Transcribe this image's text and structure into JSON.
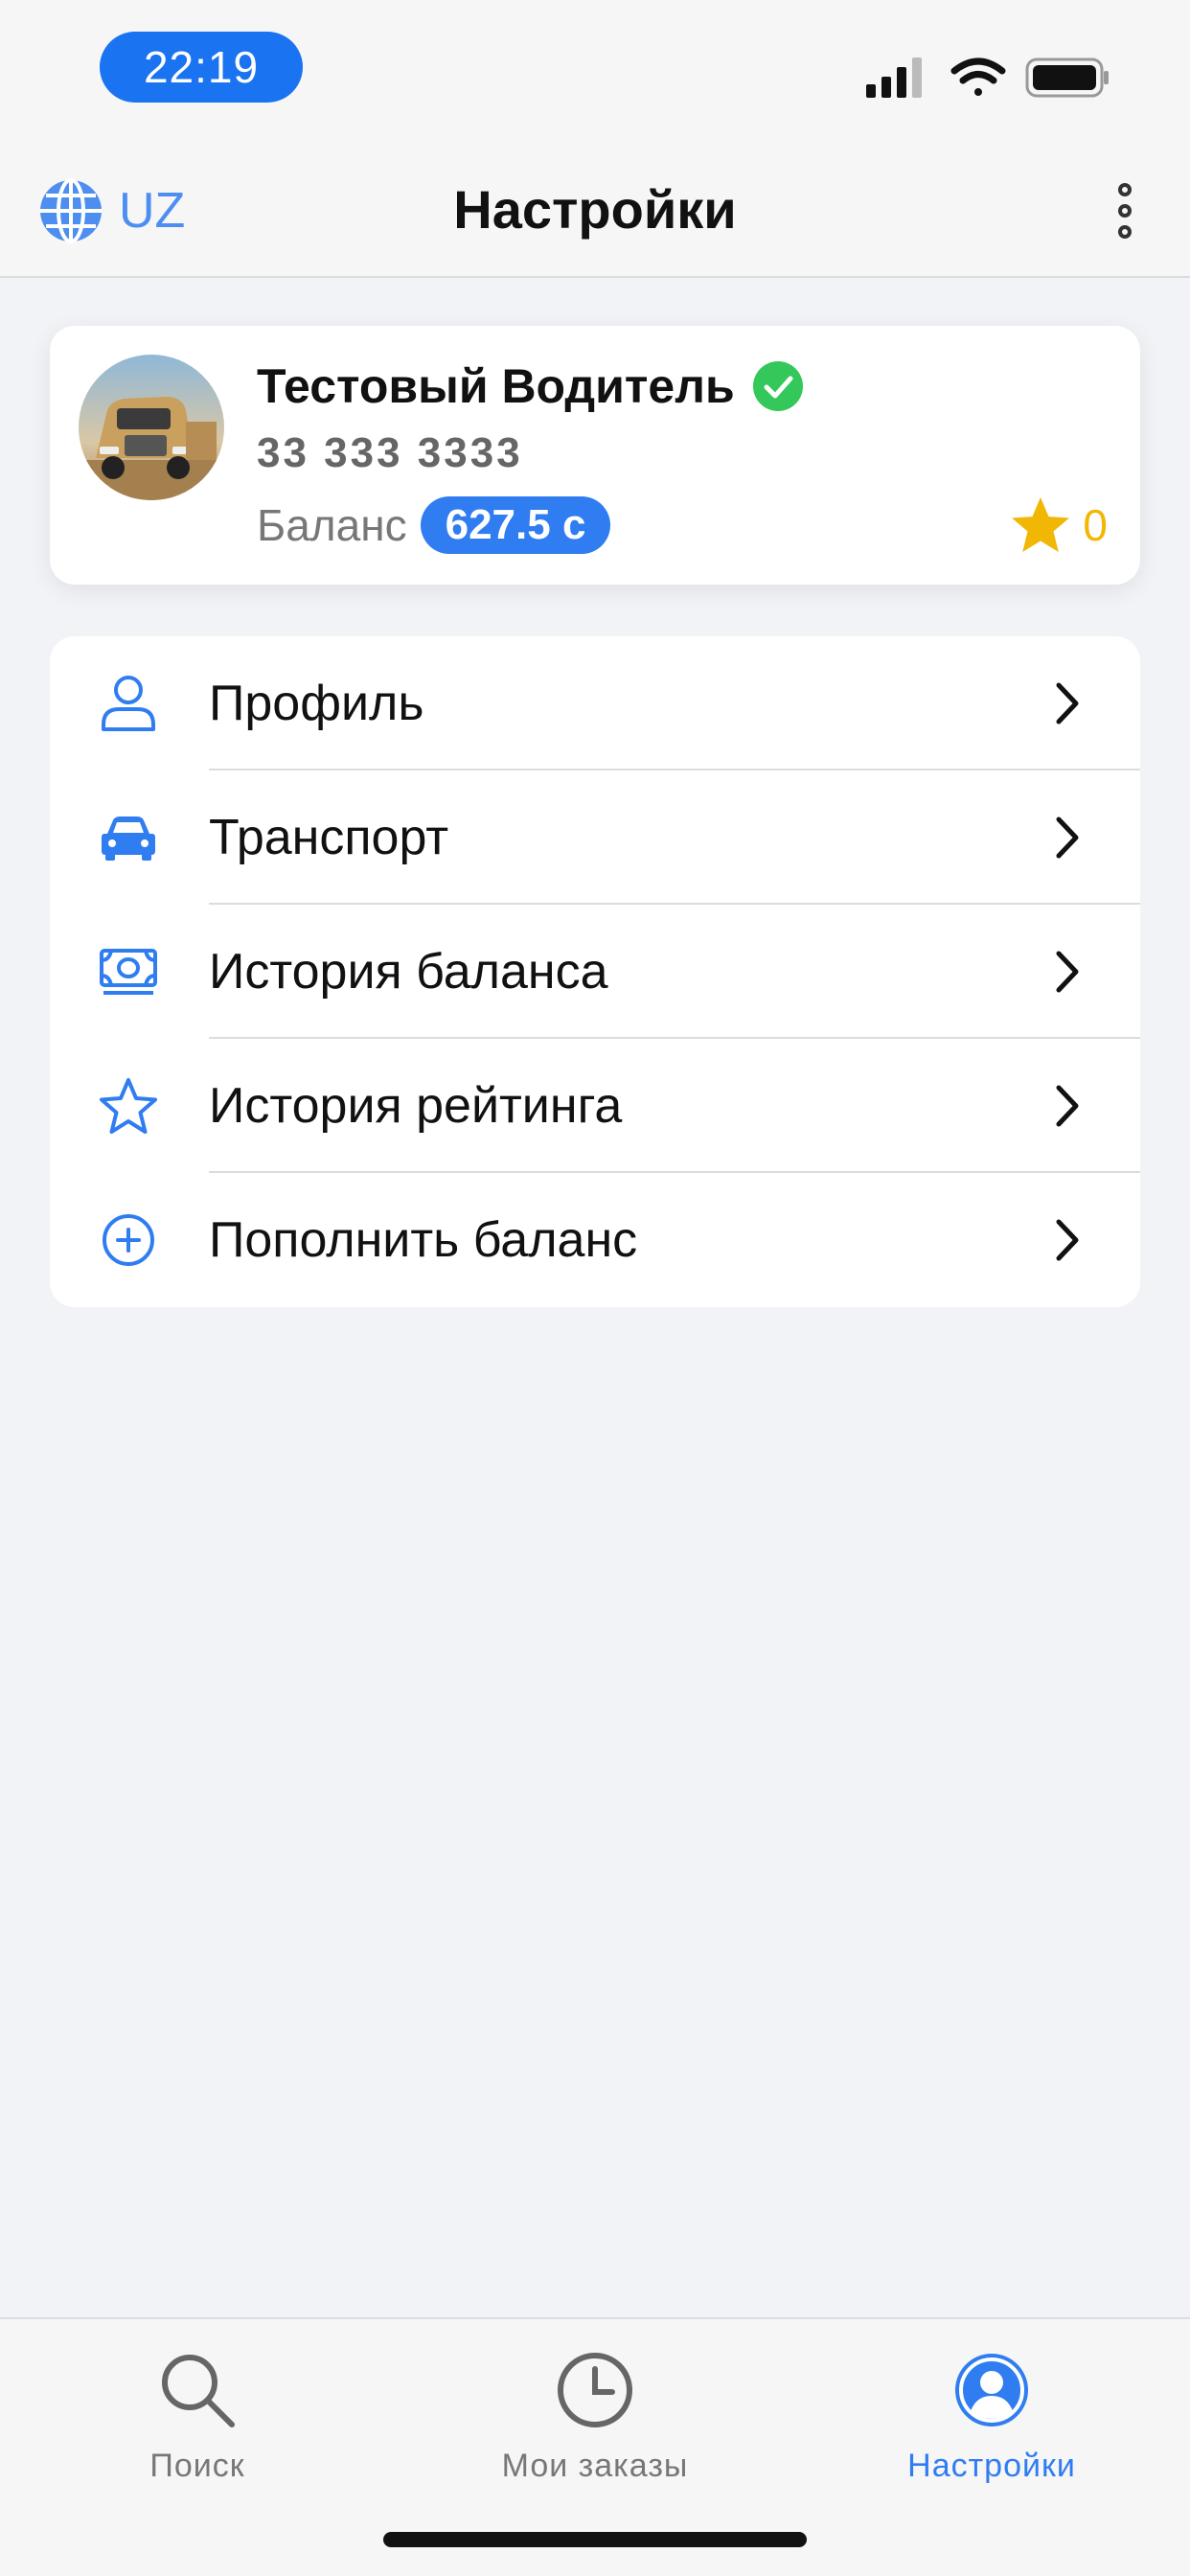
{
  "status_bar": {
    "time": "22:19",
    "icons": [
      "signal-icon",
      "wifi-icon",
      "battery-icon"
    ]
  },
  "nav_bar": {
    "language": "UZ",
    "title": "Настройки",
    "icons": [
      "globe-icon",
      "more-vertical-icon"
    ]
  },
  "profile": {
    "name": "Тестовый Водитель",
    "phone": "33 333 3333",
    "balance_label": "Баланс",
    "balance_value": "627.5 с",
    "rating": "0",
    "icons": [
      "avatar-truck-image",
      "verified-check-icon",
      "star-icon"
    ]
  },
  "menu": {
    "items": [
      {
        "label": "Профиль",
        "icon": "person-icon"
      },
      {
        "label": "Транспорт",
        "icon": "car-icon"
      },
      {
        "label": "История баланса",
        "icon": "banknote-icon"
      },
      {
        "label": "История рейтинга",
        "icon": "star-outline-icon"
      },
      {
        "label": "Пополнить баланс",
        "icon": "plus-circle-icon"
      }
    ]
  },
  "tab_bar": {
    "tabs": [
      {
        "label": "Поиск",
        "icon": "search-icon",
        "active": false
      },
      {
        "label": "Мои заказы",
        "icon": "clock-icon",
        "active": false
      },
      {
        "label": "Настройки",
        "icon": "account-circle-icon",
        "active": true
      }
    ]
  },
  "colors": {
    "accent": "#2f7df0",
    "time_pill": "#1a73f0",
    "verified": "#34c759",
    "star": "#f2b705",
    "background": "#f2f3f7"
  }
}
